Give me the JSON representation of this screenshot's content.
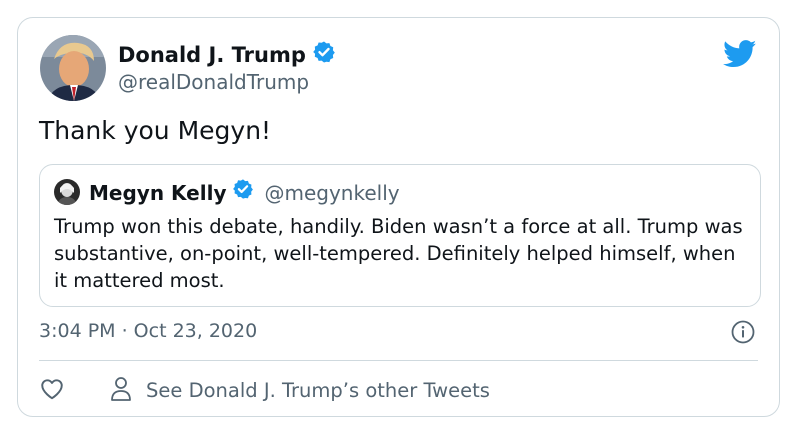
{
  "tweet": {
    "author": {
      "name": "Donald J. Trump",
      "handle": "@realDonaldTrump",
      "verified": true
    },
    "text": "Thank you Megyn!",
    "quoted_tweet": {
      "author": {
        "name": "Megyn Kelly",
        "handle": "@megynkelly",
        "verified": true
      },
      "text": "Trump won this debate, handily. Biden wasn’t a force at all. Trump was substantive, on-point, well-tempered. Definitely helped himself, when it mattered most."
    },
    "timestamp": "3:04 PM · Oct 23, 2020",
    "actions": {
      "profile_link": "See Donald J. Trump’s other Tweets"
    }
  },
  "icons": {
    "logo": "twitter-bird-icon",
    "verified": "verified-badge-icon",
    "info": "info-icon",
    "like": "heart-icon",
    "profile": "person-icon"
  },
  "colors": {
    "brand": "#1d9bf0",
    "text": "#0f1419",
    "secondary_text": "#536471",
    "border": "#cfd9de"
  }
}
